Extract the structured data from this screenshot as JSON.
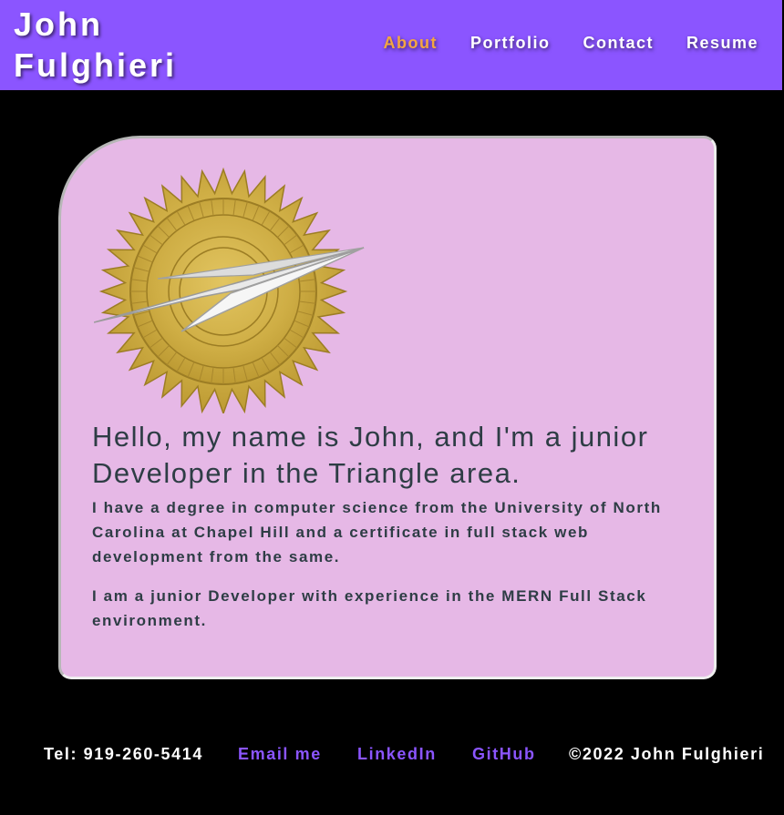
{
  "header": {
    "brand": "John Fulghieri",
    "background_color": "#8b55ff",
    "nav": [
      {
        "label": "About",
        "active": true
      },
      {
        "label": "Portfolio",
        "active": false
      },
      {
        "label": "Contact",
        "active": false
      },
      {
        "label": "Resume",
        "active": false
      }
    ],
    "active_color": "#f4a640"
  },
  "about": {
    "badge_icon": "gold-seal-with-arrow-icon",
    "headline": "Hello, my name is John, and I'm a junior Developer in the Triangle area.",
    "paragraph1": "I have a degree in computer science from the University of North Carolina at Chapel Hill and a certificate in full stack web development from the same.",
    "paragraph2": "I am a junior Developer with experience in the MERN Full Stack environment.",
    "card_color": "#e6b8e6"
  },
  "footer": {
    "phone": "Tel: 919-260-5414",
    "email_label": "Email me",
    "linkedin_label": "LinkedIn",
    "github_label": "GitHub",
    "copyright": "©2022 John Fulghieri",
    "link_color": "#8b55ff"
  }
}
